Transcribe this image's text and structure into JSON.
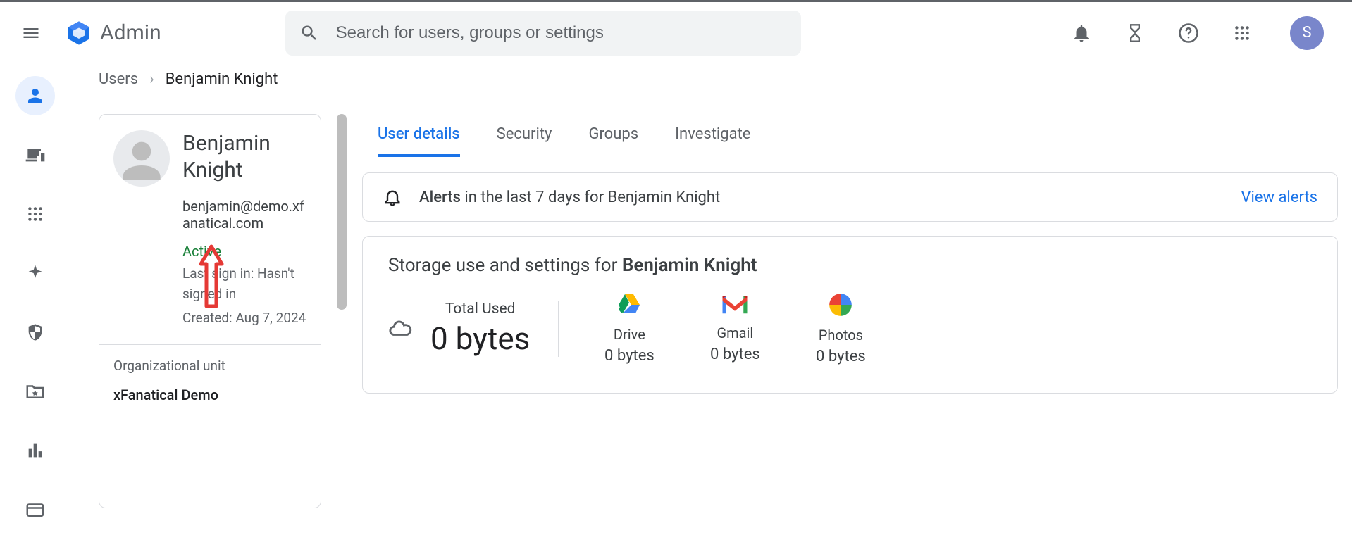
{
  "header": {
    "app_title": "Admin",
    "search_placeholder": "Search for users, groups or settings",
    "avatar_letter": "S"
  },
  "breadcrumb": {
    "parent": "Users",
    "current": "Benjamin Knight"
  },
  "user_card": {
    "name": "Benjamin Knight",
    "email": "benjamin@demo.xfanatical.com",
    "status": "Active",
    "last_sign_in": "Last sign in: Hasn't signed in",
    "created": "Created: Aug 7, 2024",
    "ou_label": "Organizational unit",
    "ou_value": "xFanatical Demo"
  },
  "tabs": [
    {
      "label": "User details",
      "active": true
    },
    {
      "label": "Security",
      "active": false
    },
    {
      "label": "Groups",
      "active": false
    },
    {
      "label": "Investigate",
      "active": false
    }
  ],
  "alerts": {
    "prefix": "Alerts",
    "text": " in the last 7 days for Benjamin Knight",
    "action": "View alerts"
  },
  "storage": {
    "title_prefix": "Storage use and settings for ",
    "title_name": "Benjamin Knight",
    "total_label": "Total Used",
    "total_value": "0 bytes",
    "services": [
      {
        "name": "Drive",
        "value": "0 bytes"
      },
      {
        "name": "Gmail",
        "value": "0 bytes"
      },
      {
        "name": "Photos",
        "value": "0 bytes"
      }
    ]
  }
}
